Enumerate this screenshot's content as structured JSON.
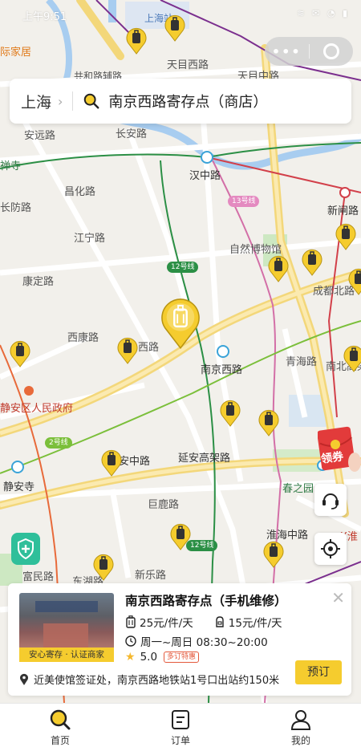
{
  "status_bar": {
    "time": "上午9:51",
    "icons": "≋ ✉ ◔ ▮"
  },
  "search": {
    "city": "上海",
    "keyword": "南京西路寄存点（商店）"
  },
  "map": {
    "labels": {
      "shanghai_station": "上海站",
      "intl_home": "际家居",
      "tianmu_w1": "天目西路",
      "tianmu_w2": "天目中路",
      "road_fu": "共和路辅路",
      "anyuan": "安远路",
      "changan": "长安路",
      "hanzhong": "汉中路",
      "xinzha": "新闸路",
      "changshou_temple": "禅寺",
      "changfang": "昌化路",
      "jiangning": "江宁路",
      "lu_fang": "长防路",
      "kangding": "康定路",
      "museum": "自然博物馆",
      "chengdu_n": "成都北路",
      "xikang": "西康路",
      "nanjing_w_rd": "西路",
      "nanjing_w": "南京西路",
      "qinghai": "青海路",
      "nanbei": "南北高架路",
      "jingan_gov": "静安区人民政府",
      "jingan_temple": "静安寺",
      "yanan_elev": "延安高架路",
      "yanan_mid": "安中路",
      "chunzhiyuan": "春之园",
      "julu": "巨鹿路",
      "huaihai": "淮海中路",
      "xinle": "新乐路",
      "donghu": "东湖路",
      "fumin": "富民路",
      "hx": "X淮"
    },
    "line_badges": {
      "l13": "13号线",
      "l12a": "12号线",
      "l2": "2号线",
      "l12b": "12号线"
    }
  },
  "coupon": {
    "label": "领券"
  },
  "store": {
    "name": "南京西路寄存点（手机维修）",
    "badge": "安心寄存 · 认证商家",
    "price_large": "25元/件/天",
    "price_small": "15元/件/天",
    "hours": "周一~周日 08:30~20:00",
    "rating": "5.0",
    "rating_tag": "多订特惠",
    "address": "近美使馆签证处，南京西路地铁站1号口出站约150米",
    "book_label": "预订"
  },
  "tabs": [
    {
      "label": "首页"
    },
    {
      "label": "订单"
    },
    {
      "label": "我的"
    }
  ],
  "colors": {
    "accent": "#f5cc2e",
    "shield": "#2fbf9a",
    "coupon": "#e23b3b"
  }
}
